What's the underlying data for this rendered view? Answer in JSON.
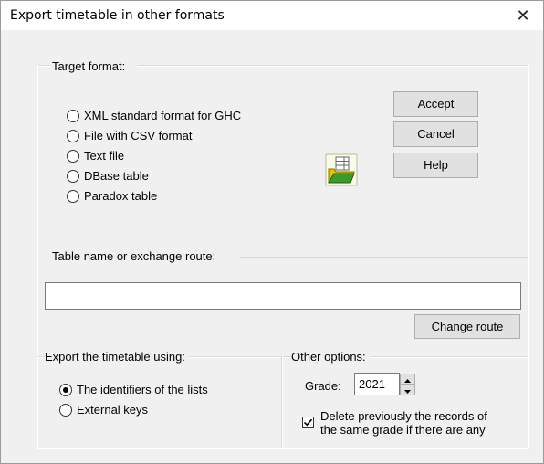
{
  "window": {
    "title": "Export timetable in other formats"
  },
  "target_format": {
    "label": "Target format:",
    "options": [
      "XML standard format for GHC",
      "File with CSV format",
      "Text file",
      "DBase table",
      "Paradox table"
    ]
  },
  "buttons": {
    "accept": "Accept",
    "cancel": "Cancel",
    "help": "Help",
    "change_route": "Change route"
  },
  "route": {
    "label": "Table name or exchange route:",
    "value": ""
  },
  "export_using": {
    "label": "Export the timetable using:",
    "options": [
      "The identifiers of the lists",
      "External keys"
    ],
    "selected": 0
  },
  "other_options": {
    "label": "Other options:",
    "grade_label": "Grade:",
    "grade_value": "2021",
    "delete_line1": "Delete previously the records of",
    "delete_line2": "the same grade if there are any",
    "delete_checked": true
  }
}
